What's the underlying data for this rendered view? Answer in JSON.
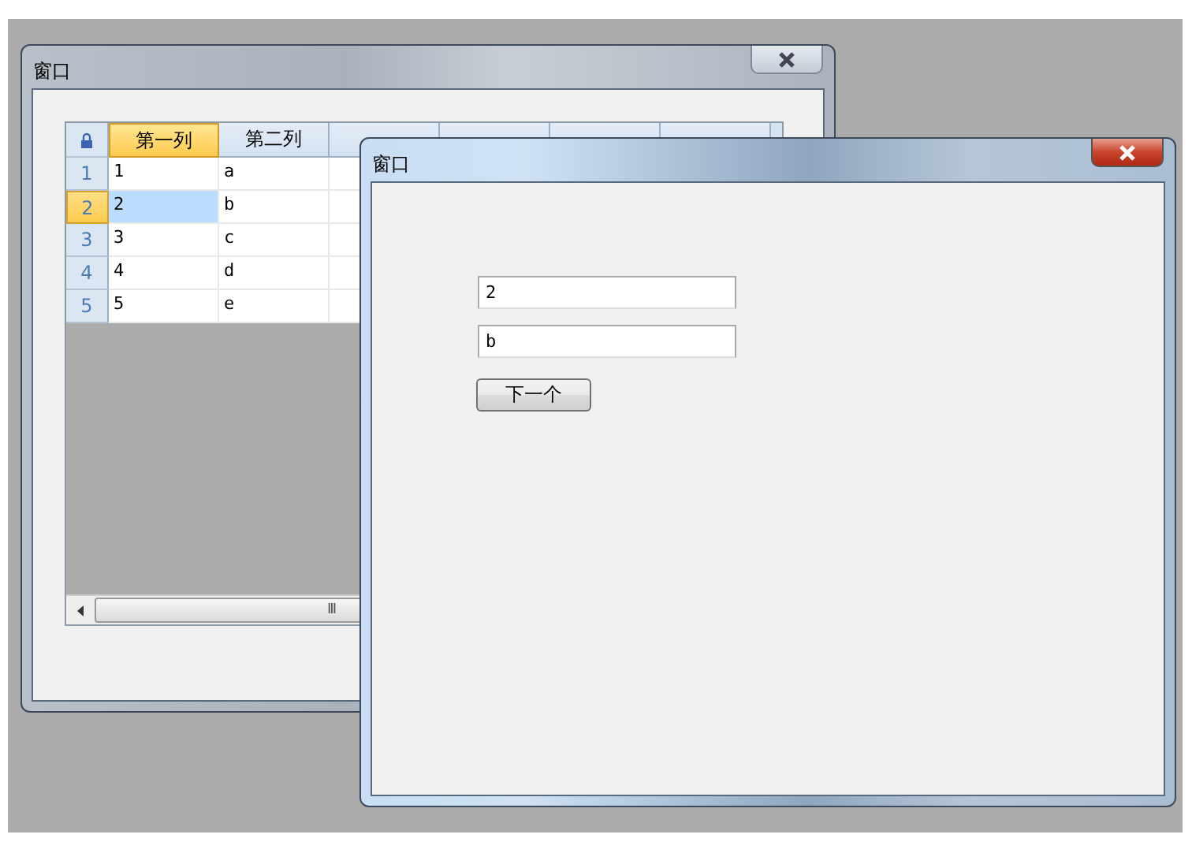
{
  "windows": [
    {
      "kind": "grid",
      "title": "窗口",
      "active": false,
      "grid": {
        "columns": [
          {
            "label": "第一列",
            "selected": true
          },
          {
            "label": "第二列",
            "selected": false
          },
          {
            "selected": false
          },
          {
            "selected": false
          },
          {
            "selected": false
          },
          {
            "selected": false
          }
        ],
        "rows": [
          {
            "header": "1",
            "cells": [
              "1",
              "a"
            ],
            "selected": false
          },
          {
            "header": "2",
            "cells": [
              "2",
              "b"
            ],
            "selected": true
          },
          {
            "header": "3",
            "cells": [
              "3",
              "c"
            ],
            "selected": false
          },
          {
            "header": "4",
            "cells": [
              "4",
              "d"
            ],
            "selected": false
          },
          {
            "header": "5",
            "cells": [
              "5",
              "e"
            ],
            "selected": false
          }
        ],
        "scroll_grip": "III"
      }
    },
    {
      "kind": "form",
      "title": "窗口",
      "active": true,
      "fields": [
        {
          "value": "2"
        },
        {
          "value": "b"
        }
      ],
      "button": "下一个"
    }
  ]
}
